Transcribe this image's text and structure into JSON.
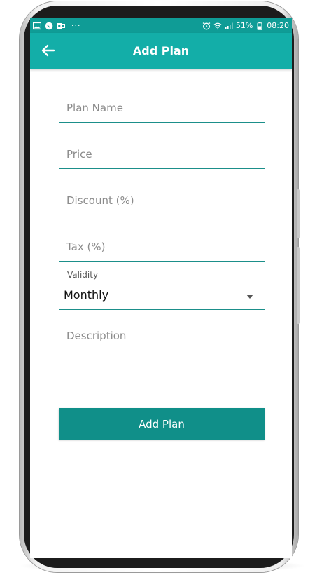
{
  "status_bar": {
    "left_icons": [
      "gallery-icon",
      "whatsapp-icon",
      "outlook-icon"
    ],
    "more": "···",
    "battery": "51%",
    "time": "08:20"
  },
  "app_bar": {
    "title": "Add Plan"
  },
  "form": {
    "plan_name_placeholder": "Plan Name",
    "price_placeholder": "Price",
    "discount_placeholder": "Discount (%)",
    "tax_placeholder": "Tax (%)",
    "validity_label": "Validity",
    "validity_value": "Monthly",
    "description_placeholder": "Description",
    "submit_label": "Add Plan"
  },
  "colors": {
    "status_bar": "#0f9c96",
    "app_bar": "#13aea8",
    "button": "#108f89",
    "underline": "#1b8f8a"
  }
}
